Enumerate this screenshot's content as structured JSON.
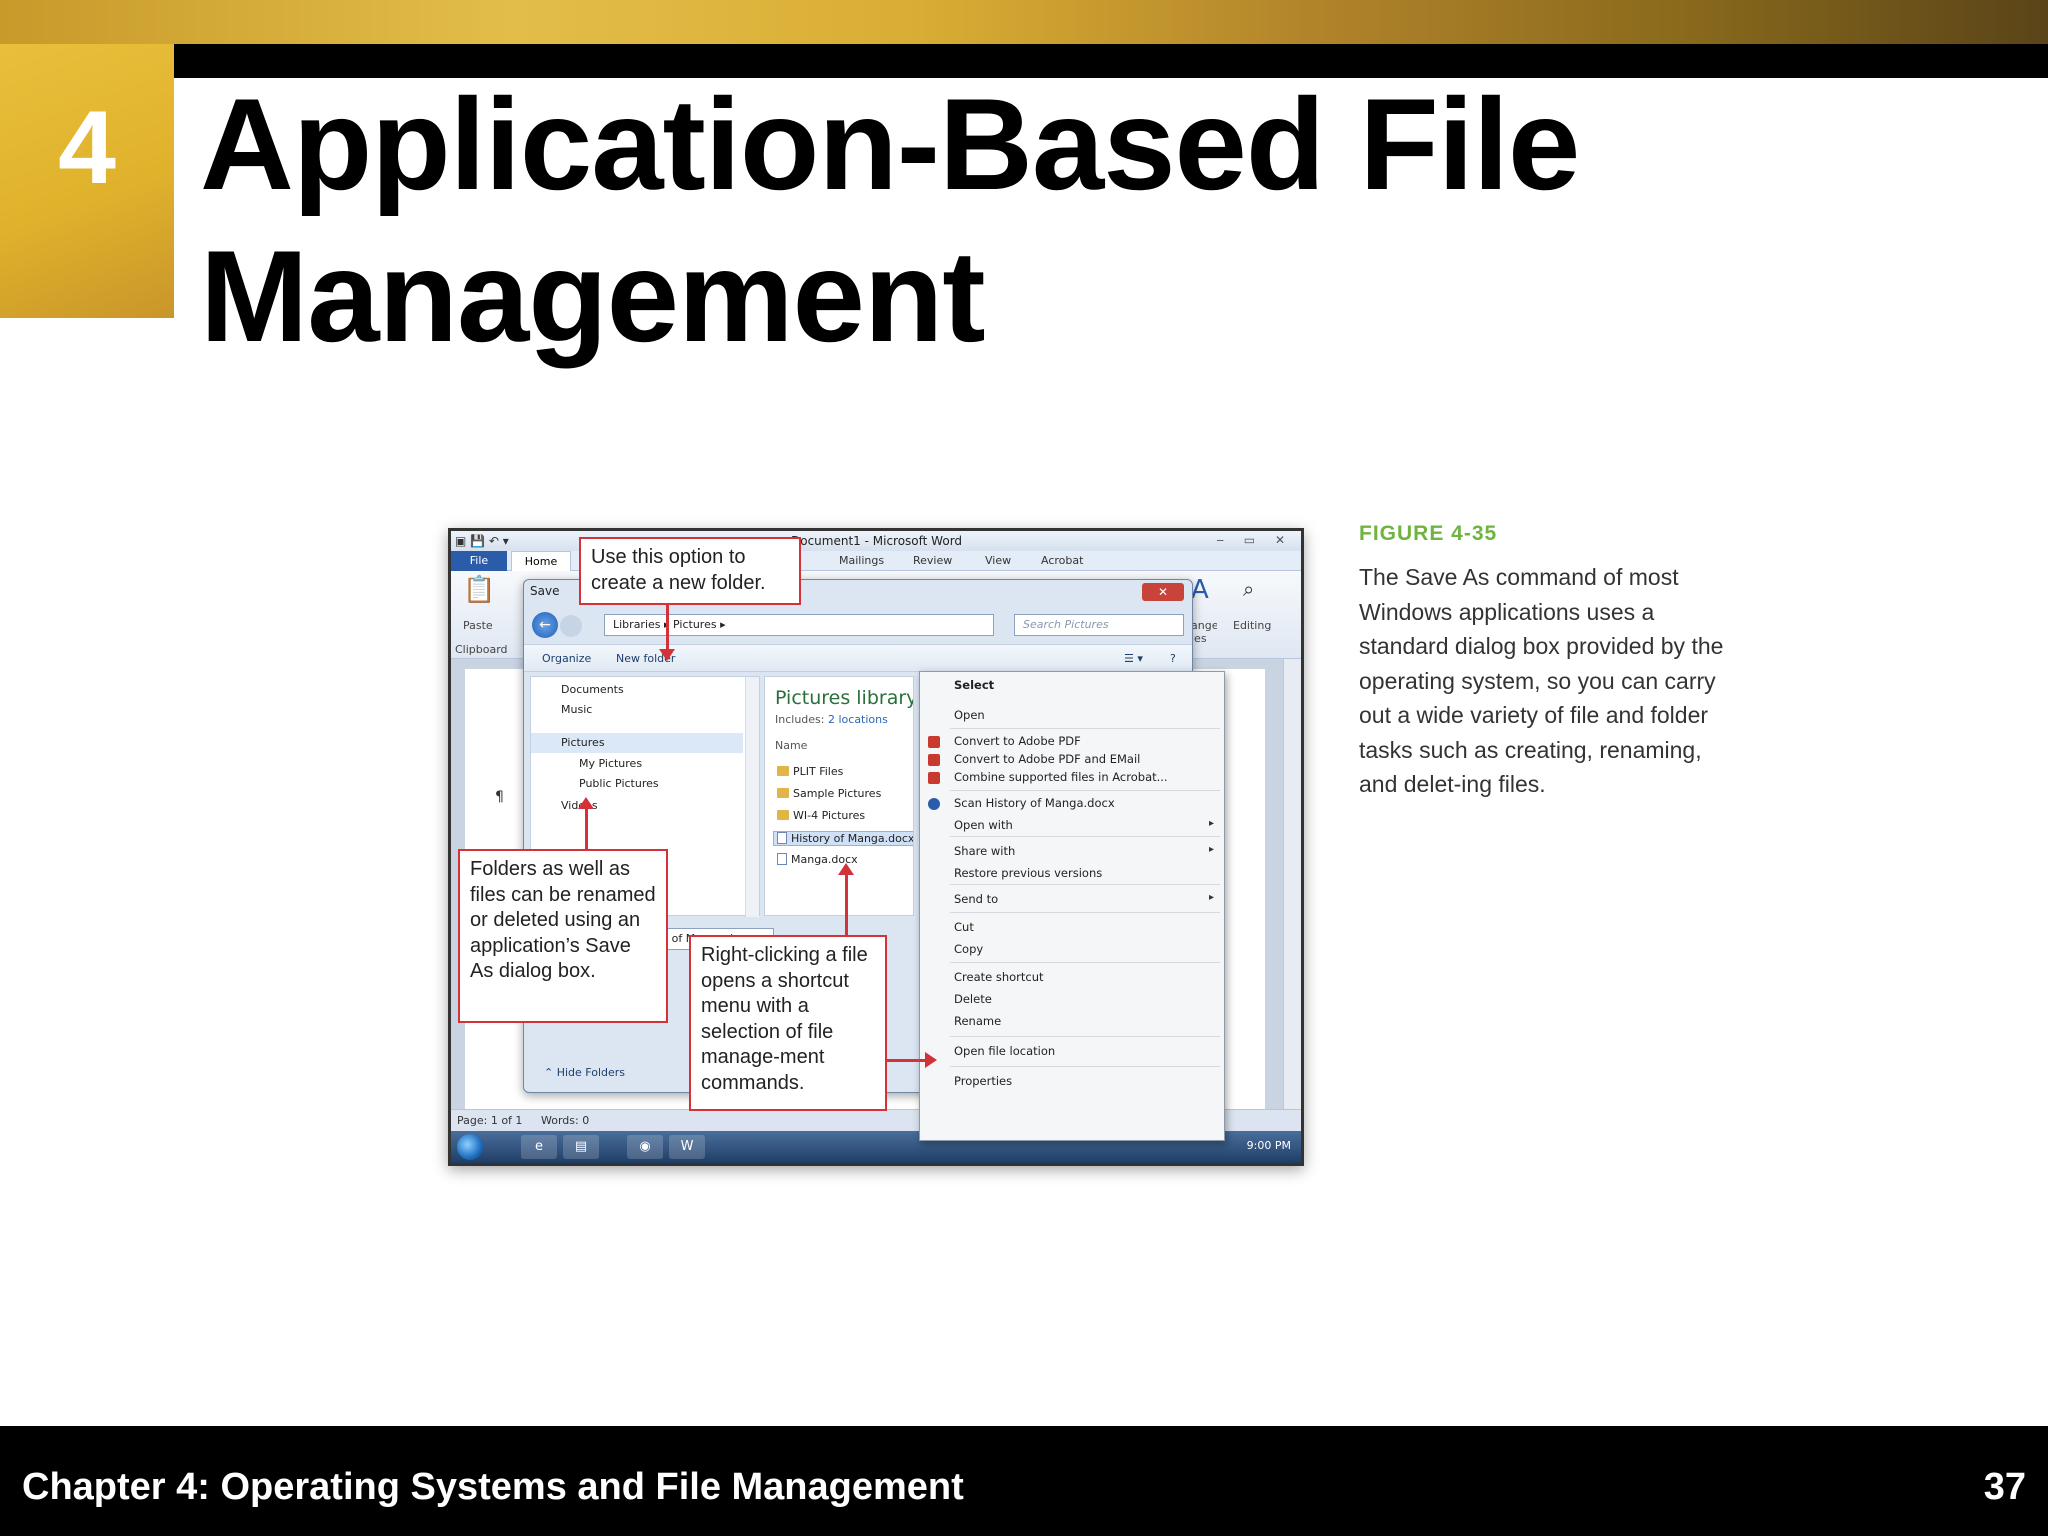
{
  "slide": {
    "chapter_number": "4",
    "title_line1": "Application-Based File",
    "title_line2": "Management",
    "footer_text": "Chapter 4: Operating Systems and File Management",
    "page_number": "37"
  },
  "figure": {
    "label": "FIGURE 4-35",
    "caption": "The Save As command of most Windows applications uses a standard dialog box provided by the operating system, so you can carry out a wide variety of file and folder tasks such as creating, renaming, and delet-ing files."
  },
  "word": {
    "window_title": "Document1 - Microsoft Word",
    "tabs": [
      "File",
      "Home",
      "Mailings",
      "Review",
      "View",
      "Acrobat"
    ],
    "ribbon": {
      "paste": "Paste",
      "clipboard": "Clipboard",
      "editing": "Editing",
      "change_styles": "ange les"
    },
    "status": {
      "page": "Page: 1 of 1",
      "words": "Words: 0"
    },
    "clock": "9:00 PM"
  },
  "dialog": {
    "title": "Save",
    "address": [
      "Libraries",
      "Pictures"
    ],
    "search_placeholder": "Search Pictures",
    "toolbar": {
      "organize": "Organize",
      "new_folder": "New folder"
    },
    "nav_items": [
      "Documents",
      "Music",
      "Pictures",
      "My Pictures",
      "Public Pictures",
      "Videos"
    ],
    "library_title": "Pictures library",
    "library_includes": "Includes:",
    "library_locations": "2 locations",
    "column_name": "Name",
    "files": [
      "PLIT Files",
      "Sample Pictures",
      "WI-4 Pictures",
      "History of Manga.docx",
      "Manga.docx"
    ],
    "file_name": "History of Manga.docx",
    "hide_folders": "Hide Folders"
  },
  "context_menu": {
    "items": [
      "Select",
      "Open",
      "Convert to Adobe PDF",
      "Convert to Adobe PDF and EMail",
      "Combine supported files in Acrobat...",
      "Scan History of Manga.docx",
      "Open with",
      "Share with",
      "Restore previous versions",
      "Send to",
      "Cut",
      "Copy",
      "Create shortcut",
      "Delete",
      "Rename",
      "Open file location",
      "Properties"
    ]
  },
  "callouts": {
    "new_folder": "Use this option to create a new folder.",
    "folders": "Folders as well as files can be renamed or deleted using an application’s Save As dialog box.",
    "right_click": "Right-clicking a file opens a shortcut menu with a selection of file manage-ment commands."
  },
  "colors": {
    "accent_gold": "#e0b22c",
    "callout_red": "#d23238",
    "figure_green": "#6fb43f"
  }
}
